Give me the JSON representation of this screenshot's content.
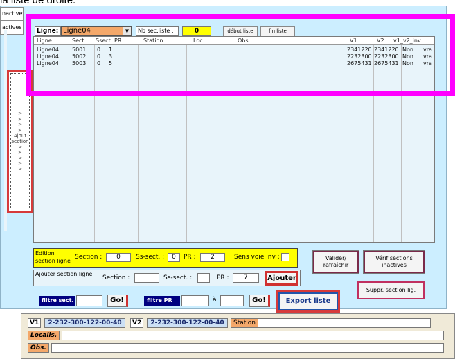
{
  "top_text": "la liste de droite.",
  "side_tabs": [
    "nactives",
    "actives"
  ],
  "ajout_section": {
    "label_line1": "Ajout",
    "label_line2": "section",
    "arrow": ">"
  },
  "selector": {
    "ligne_label": "Ligne:",
    "ligne_value": "Ligne04",
    "nb_sec_label": "Nb sec.liste :",
    "nb_sec_value": "0",
    "debut_liste": "début liste",
    "fin_liste": "fin liste"
  },
  "table": {
    "columns": [
      "Ligne",
      "Sect.",
      "Ssect",
      "PR",
      "Station",
      "Loc.",
      "Obs.",
      "V1",
      "V2",
      "v1_v2_inv"
    ],
    "rows": [
      {
        "ligne": "Ligne04",
        "sect": "5001",
        "ssect": "0",
        "pr": "1",
        "station": "",
        "loc": "",
        "obs": "",
        "v1": "2341220",
        "v2": "2341220",
        "non": "Non",
        "vra": "vra"
      },
      {
        "ligne": "Ligne04",
        "sect": "5002",
        "ssect": "0",
        "pr": "3",
        "station": "",
        "loc": "",
        "obs": "",
        "v1": "2232300",
        "v2": "2232300",
        "non": "Non",
        "vra": "vra"
      },
      {
        "ligne": "Ligne04",
        "sect": "5003",
        "ssect": "0",
        "pr": "5",
        "station": "",
        "loc": "",
        "obs": "",
        "v1": "2675431",
        "v2": "2675431",
        "non": "Non",
        "vra": "vra"
      }
    ]
  },
  "edition": {
    "title_line1": "Edition",
    "title_line2": "section ligne",
    "section_label": "Section :",
    "section_value": "0",
    "ssect_label": "Ss-sect. :",
    "ssect_value": "0",
    "pr_label": "PR :",
    "pr_value": "2",
    "sens_label": "Sens voie inv :"
  },
  "ajouter": {
    "title": "Ajouter section ligne",
    "section_label": "Section :",
    "ssect_label": "Ss-sect. :",
    "pr_label": "PR :",
    "pr_value": "7",
    "button": "Ajouter"
  },
  "filters": {
    "sect_label": "filtre sect.",
    "go": "Go!",
    "pr_label": "filtre PR",
    "a_label": "à"
  },
  "buttons": {
    "valider_line1": "Valider/",
    "valider_line2": "rafraîchir",
    "verif_line1": "Vérif sections",
    "verif_line2": "inactives",
    "suppr": "Suppr. section lig.",
    "export": "Export liste"
  },
  "info": {
    "v1_label": "V1",
    "v1_value": "2-232-300-122-00-40",
    "v2_label": "V2",
    "v2_value": "2-232-300-122-00-40",
    "station_label": "Station",
    "localis_label": "Localis.",
    "obs_label": "Obs."
  }
}
